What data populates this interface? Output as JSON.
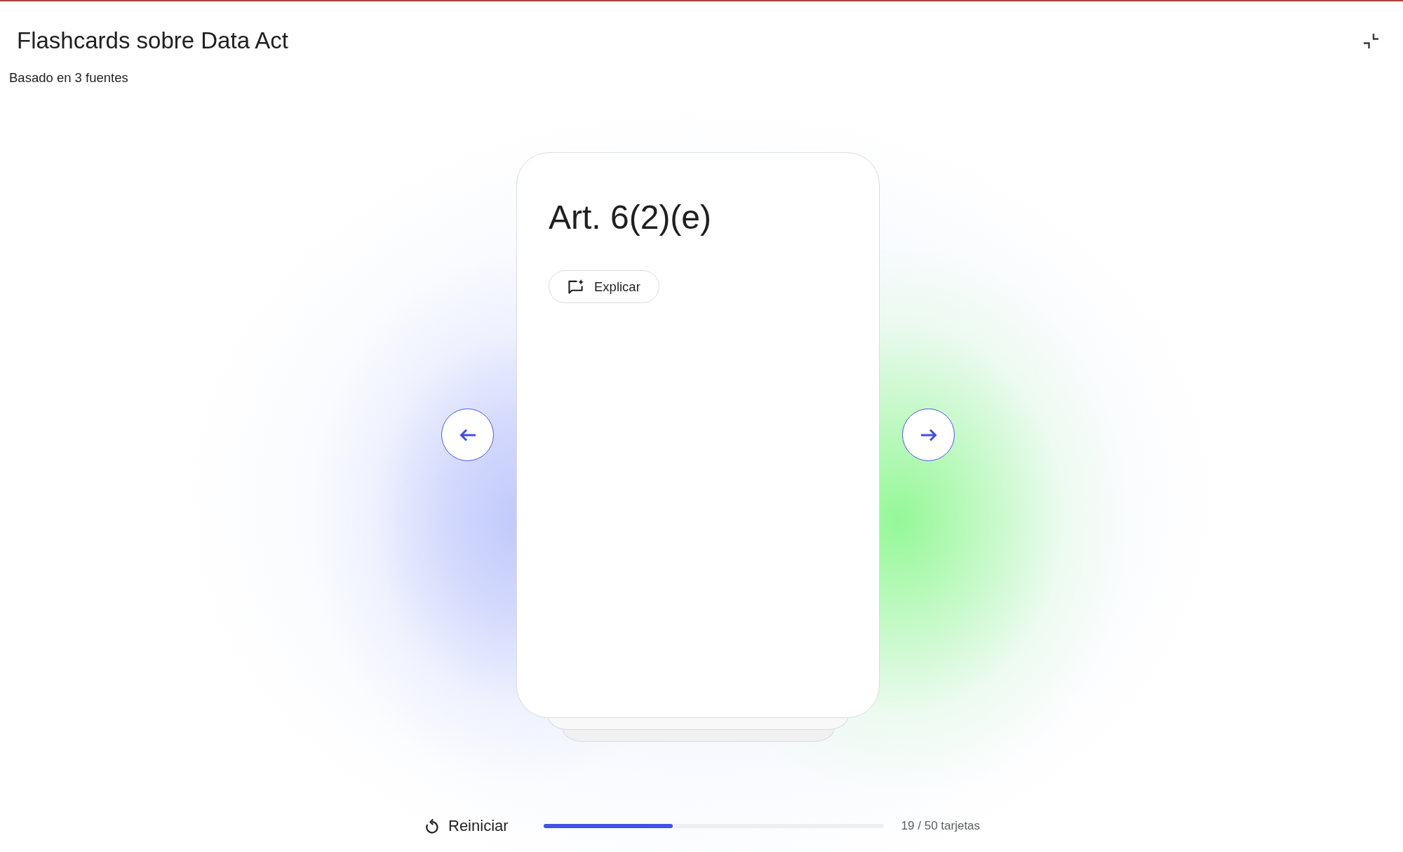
{
  "title": "Flashcards sobre Data Act",
  "subtitle": "Basado en 3 fuentes",
  "card": {
    "front": "Art. 6(2)(e)",
    "explain_button": "Explicar"
  },
  "footer": {
    "restart_button": "Reiniciar",
    "progress": {
      "level": 0.38
    },
    "count": "19 / 50 tarjetas"
  }
}
